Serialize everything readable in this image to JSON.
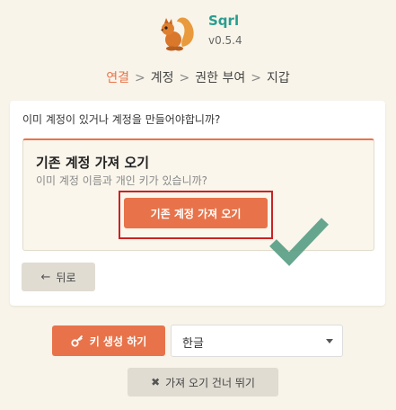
{
  "app": {
    "name": "Sqrl",
    "version": "v0.5.4"
  },
  "breadcrumb": {
    "steps": [
      "연결",
      "계정",
      "권한 부여",
      "지갑"
    ],
    "separator": ">",
    "active_color": "#e8734a"
  },
  "card": {
    "question": "이미 계정이 있거나 계정을 만들어야합니까?",
    "import": {
      "title": "기존 계정 가져 오기",
      "description": "이미 계정 이름과 개인 키가 있습니까?",
      "button_label": "기존 계정 가져 오기"
    },
    "back_label": "뒤로"
  },
  "footer": {
    "keygen_label": "키 생성 하기",
    "language_selected": "한글",
    "skip_label": "가져 오기 건너 뛰기"
  },
  "colors": {
    "accent": "#e8734a",
    "brand": "#2a9d8f",
    "highlight": "#cc2222",
    "check": "#5a9e86"
  },
  "icons": {
    "logo": "squirrel-logo-icon",
    "back": "arrow-left-icon",
    "key": "key-icon",
    "dropdown": "caret-down-icon",
    "skip": "x-icon",
    "check": "checkmark-icon"
  }
}
